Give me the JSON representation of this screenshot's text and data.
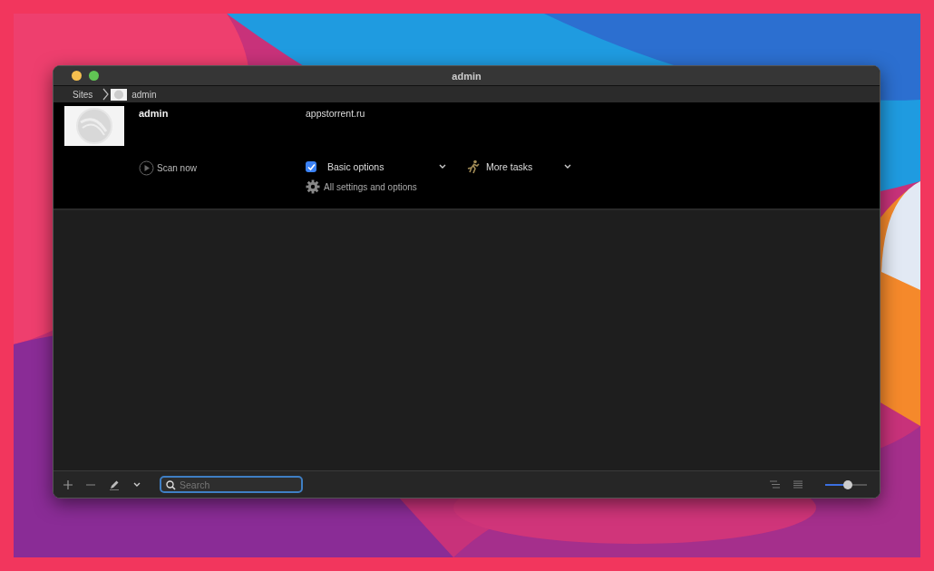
{
  "window": {
    "title": "admin"
  },
  "breadcrumb": [
    {
      "label": "Sites"
    },
    {
      "label": "admin"
    }
  ],
  "site": {
    "name": "admin",
    "url": "appstorrent.ru"
  },
  "actions": {
    "scan": "Scan now",
    "basic_options": {
      "label": "Basic options",
      "checked": true
    },
    "more_tasks": "More tasks",
    "settings": "All settings and options"
  },
  "toolbar": {
    "search": {
      "placeholder": "Search"
    },
    "zoom": {
      "level": 0.55
    }
  }
}
